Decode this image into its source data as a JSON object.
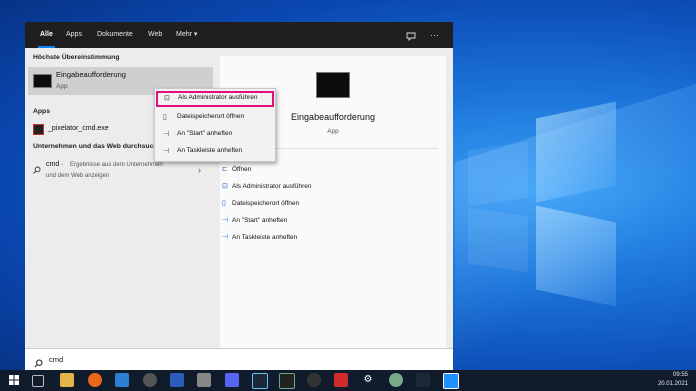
{
  "search_panel": {
    "tabs": [
      "Alle",
      "Apps",
      "Dokumente",
      "Web",
      "Mehr"
    ],
    "more_caret": "▾",
    "feedback_icon": "feedback-icon",
    "more_options_icon": "···"
  },
  "left": {
    "best_match_header": "Höchste Übereinstimmung",
    "best_match": {
      "title": "Eingabeaufforderung",
      "subtitle": "App"
    },
    "apps_header": "Apps",
    "apps": [
      {
        "label": "_pixelator_cmd.exe"
      }
    ],
    "web_header": "Unternehmen und das Web durchsuchen",
    "web_item": {
      "query": "cmd",
      "separator": " - ",
      "rest_line1": "Ergebnisse aus dem Unternehmen",
      "line2": "und dem Web anzeigen"
    }
  },
  "context_menu": {
    "items": [
      {
        "label": "Als Administrator ausführen",
        "icon": "shield-run-icon",
        "highlighted": true
      },
      {
        "label": "Dateispeicherort öffnen",
        "icon": "file-location-icon"
      },
      {
        "label": "An \"Start\" anheften",
        "icon": "pin-icon"
      },
      {
        "label": "An Taskleiste anheften",
        "icon": "pin-icon"
      }
    ]
  },
  "right": {
    "title": "Eingabeaufforderung",
    "subtitle": "App",
    "actions": [
      {
        "label": "Öffnen",
        "icon": "open-icon"
      },
      {
        "label": "Als Administrator ausführen",
        "icon": "shield-run-icon"
      },
      {
        "label": "Dateispeicherort öffnen",
        "icon": "file-location-icon"
      },
      {
        "label": "An \"Start\" anheften",
        "icon": "pin-icon"
      },
      {
        "label": "An Taskleiste anheften",
        "icon": "pin-icon"
      }
    ]
  },
  "search_box": {
    "value": "cmd",
    "icon": "search-icon"
  },
  "taskbar": {
    "time": "09:55",
    "date": "20.01.2021",
    "colors": {
      "taskbar_bg": "#101b2b",
      "accent": "#0a84ff",
      "highlight_border": "#e0117f"
    }
  }
}
